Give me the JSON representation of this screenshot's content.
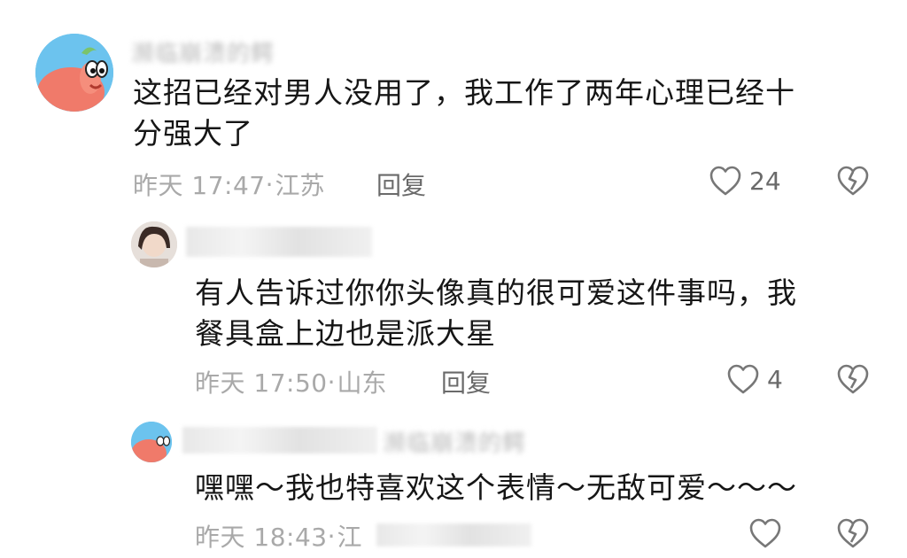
{
  "comments": [
    {
      "username": "濒临崩溃的鳄",
      "text_line1": "这招已经对男人没用了，我工作了两年心理已经十",
      "text_line2": "分强大了",
      "time": "昨天 17:47",
      "separator": "·",
      "location": "江苏",
      "reply_label": "回复",
      "likes": "24"
    },
    {
      "username": "",
      "text_line1": "有人告诉过你你头像真的很可爱这件事吗，我",
      "text_line2": "餐具盒上边也是派大星",
      "time": "昨天 17:50",
      "separator": "·",
      "location": "山东",
      "reply_label": "回复",
      "likes": "4"
    },
    {
      "username": "濒临崩溃的鳄",
      "text_line1": "嘿嘿～我也特喜欢这个表情～无敌可爱～～～",
      "time": "昨天 18:43",
      "separator": "·",
      "location": "江",
      "likes": ""
    }
  ],
  "icons": {
    "like": "heart-outline-icon",
    "dislike": "broken-heart-icon"
  },
  "colors": {
    "text": "#161616",
    "meta": "#a9a9a9",
    "action": "#6a6a6a"
  }
}
